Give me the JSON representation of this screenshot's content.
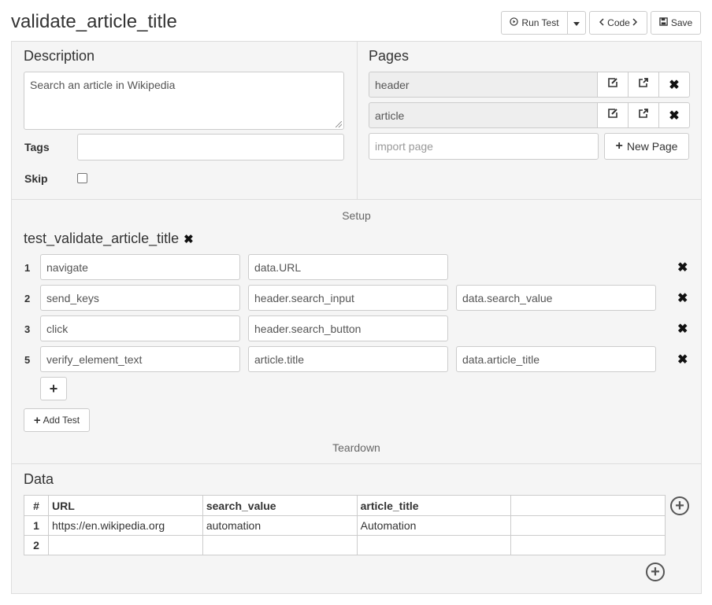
{
  "header": {
    "title": "validate_article_title",
    "run_test_label": "Run Test",
    "code_label": "Code",
    "save_label": "Save"
  },
  "description": {
    "heading": "Description",
    "value": "Search an article in Wikipedia",
    "tags_label": "Tags",
    "tags_value": "",
    "skip_label": "Skip",
    "skip_checked": false
  },
  "pages": {
    "heading": "Pages",
    "items": [
      {
        "name": "header"
      },
      {
        "name": "article"
      }
    ],
    "import_placeholder": "import page",
    "new_page_label": "New Page"
  },
  "setup": {
    "label": "Setup"
  },
  "test": {
    "name": "test_validate_article_title",
    "steps": [
      {
        "num": "1",
        "action": "navigate",
        "arg1": "data.URL",
        "arg2": ""
      },
      {
        "num": "2",
        "action": "send_keys",
        "arg1": "header.search_input",
        "arg2": "data.search_value"
      },
      {
        "num": "3",
        "action": "click",
        "arg1": "header.search_button",
        "arg2": ""
      },
      {
        "num": "5",
        "action": "verify_element_text",
        "arg1": "article.title",
        "arg2": "data.article_title"
      }
    ],
    "add_test_label": "Add Test"
  },
  "teardown": {
    "label": "Teardown"
  },
  "data": {
    "heading": "Data",
    "columns": [
      "#",
      "URL",
      "search_value",
      "article_title",
      ""
    ],
    "rows": [
      [
        "1",
        "https://en.wikipedia.org",
        "automation",
        "Automation",
        ""
      ],
      [
        "2",
        "",
        "",
        "",
        ""
      ]
    ]
  }
}
